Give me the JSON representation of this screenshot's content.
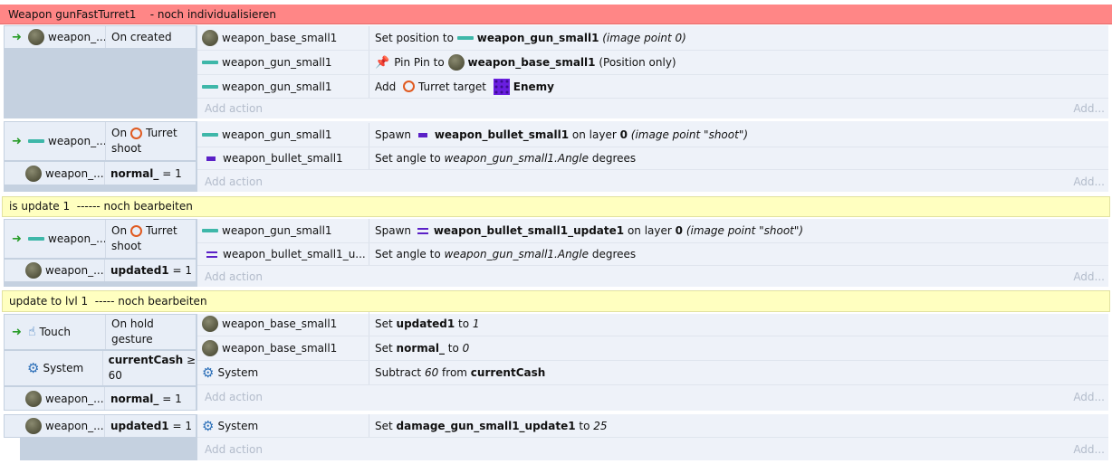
{
  "groups": [
    {
      "title": "Weapon gunFastTurret1    - noch individualisieren",
      "color": "#ff8686"
    },
    {
      "title": "is update 1  ------ noch bearbeiten",
      "color": "#ffffc0"
    },
    {
      "title": "update to lvl 1  ----- noch bearbeiten",
      "color": "#ffffc0"
    }
  ],
  "events": {
    "e1": {
      "cond1": {
        "obj": "weapon_...",
        "text": "On created"
      },
      "actions": [
        {
          "obj": "weapon_base_small1",
          "t1": "Set position to ",
          "t2": "weapon_gun_small1",
          "t3": " (image point 0)"
        },
        {
          "obj": "weapon_gun_small1",
          "t1": "Pin Pin to ",
          "t2": "weapon_base_small1",
          "t3": " (Position only)"
        },
        {
          "obj": "weapon_gun_small1",
          "t1": "Add ",
          "t2": "Turret target ",
          "t3": "Enemy"
        }
      ]
    },
    "e2": {
      "cond1": {
        "obj": "weapon_...",
        "t1": "On",
        "t2": "Turret",
        "t3": "shoot"
      },
      "cond2": {
        "obj": "weapon_...",
        "var": "normal_",
        "op": " = 1"
      },
      "actions": [
        {
          "obj": "weapon_gun_small1",
          "t1": "Spawn ",
          "t2": "weapon_bullet_small1",
          "t3": " on layer ",
          "t4": "0",
          "t5": " (image point \"shoot\")"
        },
        {
          "obj": "weapon_bullet_small1",
          "t1": "Set angle to ",
          "t2": "weapon_gun_small1.Angle",
          "t3": " degrees"
        }
      ]
    },
    "e3": {
      "cond1": {
        "obj": "weapon_...",
        "t1": "On",
        "t2": "Turret",
        "t3": "shoot"
      },
      "cond2": {
        "obj": "weapon_...",
        "var": "updated1",
        "op": " = 1"
      },
      "actions": [
        {
          "obj": "weapon_gun_small1",
          "t1": "Spawn ",
          "t2": "weapon_bullet_small1_update1",
          "t3": " on layer ",
          "t4": "0",
          "t5": " (image point \"shoot\")"
        },
        {
          "obj": "weapon_bullet_small1_u...",
          "t1": "Set angle to ",
          "t2": "weapon_gun_small1.Angle",
          "t3": " degrees"
        }
      ]
    },
    "e4": {
      "cond1": {
        "obj": "Touch",
        "t1": "On hold",
        "t2": "gesture"
      },
      "cond2": {
        "obj": "System",
        "var": "currentCash",
        "op": " ≥",
        "val": "60"
      },
      "cond3": {
        "obj": "weapon_...",
        "var": "normal_",
        "op": " = 1"
      },
      "actions": [
        {
          "obj": "weapon_base_small1",
          "t1": "Set ",
          "t2": "updated1",
          "t3": " to ",
          "t4": "1"
        },
        {
          "obj": "weapon_base_small1",
          "t1": "Set ",
          "t2": "normal_",
          "t3": " to ",
          "t4": "0"
        },
        {
          "obj": "System",
          "t1": "Subtract ",
          "t2": "60",
          "t3": " from ",
          "t4": "currentCash"
        }
      ]
    },
    "e5": {
      "cond1": {
        "obj": "weapon_...",
        "var": "updated1",
        "op": " = 1"
      },
      "actions": [
        {
          "obj": "System",
          "t1": "Set ",
          "t2": "damage_gun_small1_update1",
          "t3": " to ",
          "t4": "25"
        }
      ]
    }
  },
  "add_action": "Add action",
  "add_short": "Add..."
}
